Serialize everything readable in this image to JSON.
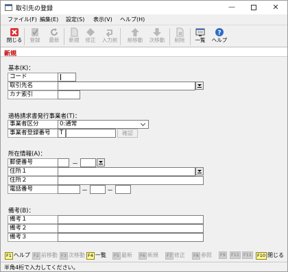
{
  "window": {
    "title": "取引先の登録"
  },
  "menu": [
    "ファイル(F)",
    "編集(E)",
    "設定(S)",
    "表示(V)",
    "ヘルプ(H)"
  ],
  "toolbar": [
    {
      "label": "閉じる",
      "icon": "close-door-icon",
      "enabled": true
    },
    {
      "label": "登録",
      "icon": "register-icon",
      "enabled": false
    },
    {
      "label": "最新",
      "icon": "refresh-icon",
      "enabled": false
    },
    {
      "label": "新規",
      "icon": "new-document-icon",
      "enabled": false
    },
    {
      "label": "修正",
      "icon": "edit-icon",
      "enabled": false
    },
    {
      "label": "入力前",
      "icon": "undo-icon",
      "enabled": false
    },
    {
      "label": "前移動",
      "icon": "arrow-up-icon",
      "enabled": false
    },
    {
      "label": "次移動",
      "icon": "arrow-down-icon",
      "enabled": false
    },
    {
      "label": "削除",
      "icon": "delete-icon",
      "enabled": false
    },
    {
      "label": "一覧",
      "icon": "list-icon",
      "enabled": true
    },
    {
      "label": "ヘルプ",
      "icon": "help-icon",
      "enabled": true
    }
  ],
  "mode_label": "新規",
  "basic": {
    "heading": "基本(K)：",
    "code_label": "コード",
    "name_label": "取引先名",
    "kana_label": "カナ索引"
  },
  "invoice": {
    "heading": "適格請求書発行事業者(T)：",
    "type_label": "事業者区分",
    "type_value": "0:通常",
    "regno_label": "事業者登録番号",
    "regno_prefix": "T",
    "confirm_button": "確認"
  },
  "address": {
    "heading": "所在情報(A)：",
    "postal_label": "郵便番号",
    "addr1_label": "住所１",
    "addr2_label": "住所２",
    "tel_label": "電話番号",
    "dash": "－"
  },
  "remarks": {
    "heading": "備考(B)：",
    "r1_label": "備考１",
    "r2_label": "備考２",
    "r3_label": "備考３"
  },
  "fkeys": [
    {
      "key": "F1",
      "name": "ヘルプ",
      "enabled": true
    },
    {
      "key": "F2",
      "name": "前移動",
      "enabled": false
    },
    {
      "key": "F3",
      "name": "次移動",
      "enabled": false
    },
    {
      "key": "F4",
      "name": "一覧",
      "enabled": true
    },
    {
      "key": "F5",
      "name": "最新",
      "enabled": false
    },
    {
      "key": "F6",
      "name": "新規",
      "enabled": false
    },
    {
      "key": "F7",
      "name": "修正",
      "enabled": false
    },
    {
      "key": "F8",
      "name": "参照",
      "enabled": false
    },
    {
      "key": "F9",
      "name": "",
      "enabled": false
    },
    {
      "key": "F11",
      "name": "",
      "enabled": false
    },
    {
      "key": "F11",
      "name": "",
      "enabled": false
    },
    {
      "key": "F10",
      "name": "閉じる",
      "enabled": true
    }
  ],
  "status_text": "半角4桁で入力してください。"
}
